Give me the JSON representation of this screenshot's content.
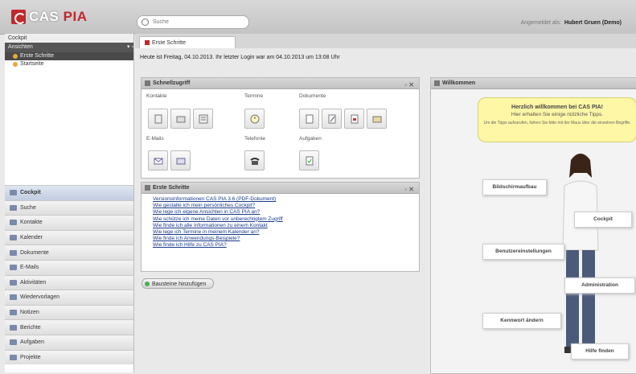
{
  "app": {
    "logo_cas": "CAS",
    "logo_pia": "PIA",
    "user_label": "Angemeldet als:",
    "user_name": "Hubert Gruen (Demo)"
  },
  "search": {
    "placeholder": "Suche"
  },
  "sidebar": {
    "header": "Cockpit",
    "sub_header": "Ansichten",
    "items": [
      {
        "label": "Erste Schritte",
        "selected": true
      },
      {
        "label": "Startseite",
        "selected": false
      }
    ],
    "nav": [
      {
        "label": "Cockpit",
        "selected": true
      },
      {
        "label": "Suche"
      },
      {
        "label": "Kontakte"
      },
      {
        "label": "Kalender"
      },
      {
        "label": "Dokumente"
      },
      {
        "label": "E-Mails"
      },
      {
        "label": "Aktivitäten"
      },
      {
        "label": "Wiedervorlagen"
      },
      {
        "label": "Notizen"
      },
      {
        "label": "Berichte"
      },
      {
        "label": "Aufgaben"
      },
      {
        "label": "Projekte"
      }
    ]
  },
  "tab": {
    "label": "Erste Schritte"
  },
  "greeting": "Heute ist Freitag, 04.10.2013. Ihr letzter Login war am 04.10.2013 um 13:08 Uhr",
  "schnellzugriff": {
    "title": "Schnellzugriff",
    "groups": {
      "kontakte": "Kontakte",
      "termine": "Termine",
      "dokumente": "Dokumente",
      "emails": "E-Mails",
      "telefonie": "Telefonie",
      "aufgaben": "Aufgaben"
    }
  },
  "erste_schritte": {
    "title": "Erste Schritte",
    "links": [
      "Versionsinformationen CAS PIA 3.6 (PDF-Dokument)",
      "Wie gestalte ich mein persönliches Cockpit?",
      "Wie lege ich eigene Ansichten in CAS PIA an?",
      "Wie schütze ich meine Daten vor unberechtigtem Zugriff",
      "Wie finde ich alle Informationen zu einem Kontakt",
      "Wie lege ich Termine in meinem Kalender an?",
      "Wie finde ich Anwendungs-Beispiele?",
      "Wie finde ich Hilfe zu CAS PIA?"
    ]
  },
  "add_button": "Bausteine hinzufügen",
  "welcome": {
    "title": "Willkommen",
    "bubble_line1": "Herzlich willkommen bei CAS PIA!",
    "bubble_line2": "Hier erhalten Sie einige nützliche Tipps.",
    "bubble_line3": "Um die Tipps aufzurufen, fahren Sie bitte mit der Maus über die einzelnen Begriffe.",
    "labels": [
      "Bildschirmaufbau",
      "Cockpit",
      "Benutzereinstellungen",
      "Administration",
      "Kennwort ändern",
      "Hilfe finden"
    ]
  }
}
